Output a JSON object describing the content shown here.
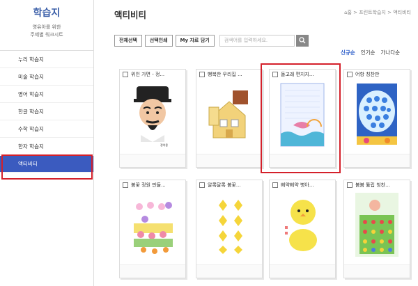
{
  "sidebar": {
    "brand": "학습지",
    "subtitle_line1": "영유아를 위한",
    "subtitle_line2": "주제별 워크시트",
    "items": [
      {
        "label": "누리 학습지"
      },
      {
        "label": "미술 학습지"
      },
      {
        "label": "영어 학습지"
      },
      {
        "label": "한글 학습지"
      },
      {
        "label": "수학 학습지"
      },
      {
        "label": "한자 학습지"
      },
      {
        "label": "액티비티",
        "active": true
      }
    ]
  },
  "header": {
    "title": "액티비티",
    "breadcrumb": "⌂홈 > 프린트학습지 > 액티비티"
  },
  "toolbar": {
    "select_all": "전체선택",
    "print_selected": "선택인쇄",
    "add_my": "My 자료 담기",
    "search_placeholder": "검색어를 입력하세요."
  },
  "sort": [
    "신규순",
    "인기순",
    "가나다순"
  ],
  "cards": [
    {
      "title": "위인 가면 - 정..."
    },
    {
      "title": "뻥복한 우리집 ..."
    },
    {
      "title": "돌고래 편지지..."
    },
    {
      "title": "어항 칭찬판"
    },
    {
      "title": "봄꽃 정원 만들..."
    },
    {
      "title": "알록달록 봄꽃..."
    },
    {
      "title": "삐약삐약 병아..."
    },
    {
      "title": "봄봄 튤립 칭찬..."
    }
  ],
  "mask_caption": "정약용",
  "colors": {
    "accent": "#3b5bbf",
    "highlight": "#d4202a"
  }
}
